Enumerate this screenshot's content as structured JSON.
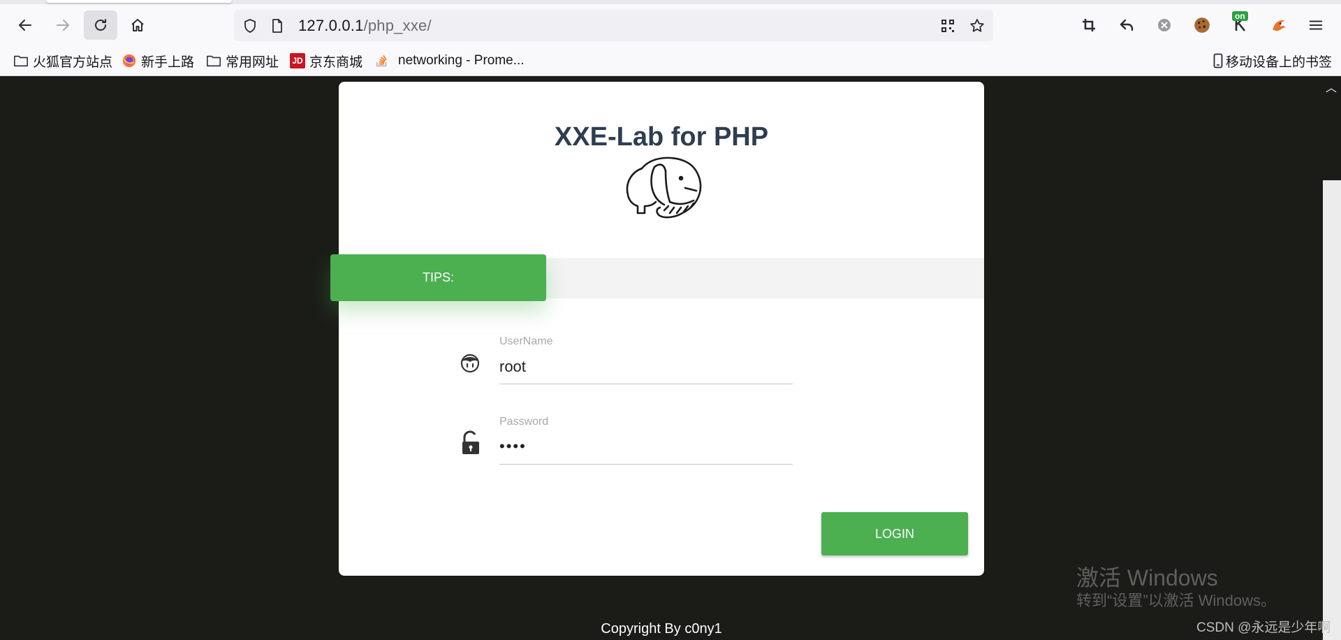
{
  "browser": {
    "url_host": "127.0.0.1",
    "url_path": "/php_xxe/",
    "on_badge": "on",
    "bookmarks": [
      {
        "label": "火狐官方站点",
        "icon": "folder-icon"
      },
      {
        "label": "新手上路",
        "icon": "firefox-icon"
      },
      {
        "label": "常用网址",
        "icon": "folder-icon"
      },
      {
        "label": "京东商城",
        "icon": "jd-icon",
        "icon_text": "JD"
      },
      {
        "label": "networking - Prome...",
        "icon": "stackoverflow-icon"
      }
    ],
    "mobile_bookmarks": "移动设备上的书签"
  },
  "page": {
    "title": "XXE-Lab for PHP",
    "tips_label": "TIPS:",
    "username": {
      "label": "UserName",
      "value": "root"
    },
    "password": {
      "label": "Password",
      "value": "••••"
    },
    "login_label": "LOGIN",
    "copyright": "Copyright By c0ny1"
  },
  "overlay": {
    "activate_line1": "激活 Windows",
    "activate_line2": "转到“设置”以激活 Windows。",
    "csdn": "CSDN @永远是少年啊"
  },
  "colors": {
    "accent_green": "#4caf50",
    "title_color": "#2f3d50",
    "page_background": "#1b1c18"
  }
}
